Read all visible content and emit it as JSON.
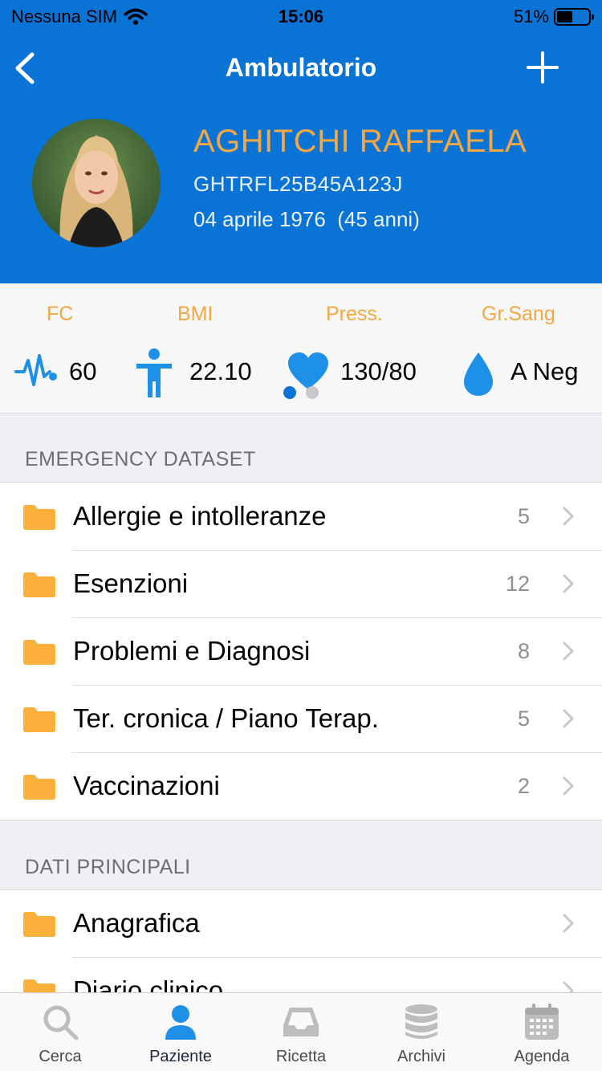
{
  "status_bar": {
    "carrier": "Nessuna SIM",
    "time": "15:06",
    "battery": "51%",
    "battery_level": 0.51
  },
  "header": {
    "title": "Ambulatorio",
    "back_icon": "chevron-left-icon",
    "add_icon": "plus-icon"
  },
  "patient": {
    "name": "AGHITCHI RAFFAELA",
    "fiscal_code": "GHTRFL25B45A123J",
    "birth": "04 aprile 1976  (45 anni)"
  },
  "vitals": [
    {
      "label": "FC",
      "value": "60",
      "icon": "heartbeat-icon"
    },
    {
      "label": "BMI",
      "value": "22.10",
      "icon": "person-icon"
    },
    {
      "label": "Press.",
      "value": "130/80",
      "icon": "heart-icon"
    },
    {
      "label": "Gr.Sang",
      "value": "A Neg",
      "icon": "blood-drop-icon"
    }
  ],
  "pager": {
    "pages": 2,
    "current": 1
  },
  "sections": [
    {
      "title": "EMERGENCY DATASET",
      "items": [
        {
          "label": "Allergie e intolleranze",
          "count": "5"
        },
        {
          "label": "Esenzioni",
          "count": "12"
        },
        {
          "label": "Problemi e Diagnosi",
          "count": "8"
        },
        {
          "label": "Ter. cronica / Piano Terap.",
          "count": "5"
        },
        {
          "label": "Vaccinazioni",
          "count": "2"
        }
      ]
    },
    {
      "title": "DATI PRINCIPALI",
      "items": [
        {
          "label": "Anagrafica",
          "count": ""
        },
        {
          "label": "Diario clinico",
          "count": ""
        }
      ]
    }
  ],
  "tabbar": [
    {
      "label": "Cerca",
      "icon": "search-icon",
      "active": false
    },
    {
      "label": "Paziente",
      "icon": "person-icon",
      "active": true
    },
    {
      "label": "Ricetta",
      "icon": "inbox-icon",
      "active": false
    },
    {
      "label": "Archivi",
      "icon": "database-icon",
      "active": false
    },
    {
      "label": "Agenda",
      "icon": "calendar-icon",
      "active": false
    }
  ],
  "colors": {
    "primary": "#0a73d6",
    "accent": "#f5a742",
    "folder": "#fbb03b",
    "icon_blue": "#1e90e8"
  }
}
